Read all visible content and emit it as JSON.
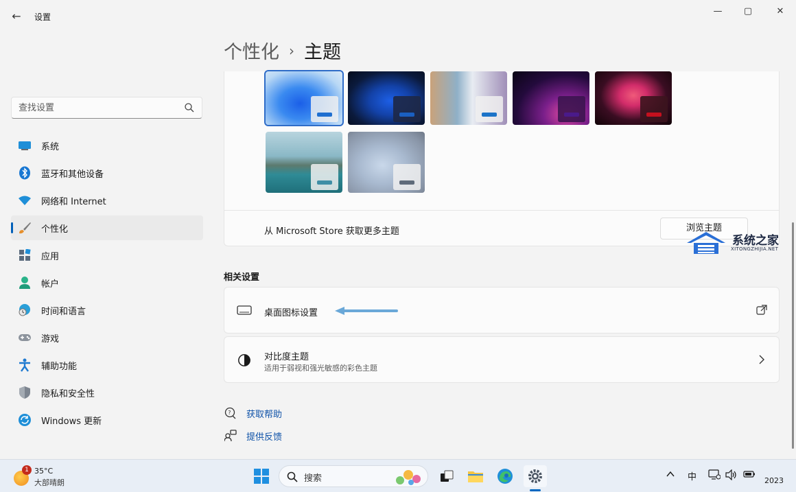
{
  "window": {
    "title": "设置",
    "controls": [
      "—",
      "▢",
      "✕"
    ]
  },
  "sidebar": {
    "search_placeholder": "查找设置",
    "items": [
      {
        "label": "系统",
        "icon": "system-icon",
        "active": false
      },
      {
        "label": "蓝牙和其他设备",
        "icon": "bluetooth-icon",
        "active": false
      },
      {
        "label": "网络和 Internet",
        "icon": "wifi-icon",
        "active": false
      },
      {
        "label": "个性化",
        "icon": "brush-icon",
        "active": true
      },
      {
        "label": "应用",
        "icon": "apps-icon",
        "active": false
      },
      {
        "label": "帐户",
        "icon": "account-icon",
        "active": false
      },
      {
        "label": "时间和语言",
        "icon": "globe-clock-icon",
        "active": false
      },
      {
        "label": "游戏",
        "icon": "gamepad-icon",
        "active": false
      },
      {
        "label": "辅助功能",
        "icon": "accessibility-icon",
        "active": false
      },
      {
        "label": "隐私和安全性",
        "icon": "shield-icon",
        "active": false
      },
      {
        "label": "Windows 更新",
        "icon": "update-icon",
        "active": false
      }
    ]
  },
  "breadcrumb": {
    "parent": "个性化",
    "separator": "›",
    "current": "主题"
  },
  "themes": {
    "store_text": "从 Microsoft Store 获取更多主题",
    "browse_label": "浏览主题",
    "accent_colors": [
      "#1f6fd0",
      "#1a5fc0",
      "#1c73c8",
      "#4a1a8a",
      "#c4101e",
      "#3f8ea6",
      "#5f6b7a"
    ]
  },
  "related": {
    "title": "相关设置",
    "desktop_icons": {
      "label": "桌面图标设置"
    },
    "contrast": {
      "label": "对比度主题",
      "description": "适用于弱视和强光敏感的彩色主题"
    }
  },
  "help": {
    "get_help": "获取帮助",
    "feedback": "提供反馈"
  },
  "watermark": {
    "text": "系统之家",
    "sub": "XITONGZHIJIA.NET"
  },
  "taskbar": {
    "weather_badge": "1",
    "temperature": "35°C",
    "condition": "大部晴朗",
    "search_label": "搜索",
    "ime": "中",
    "clock": "2023"
  }
}
